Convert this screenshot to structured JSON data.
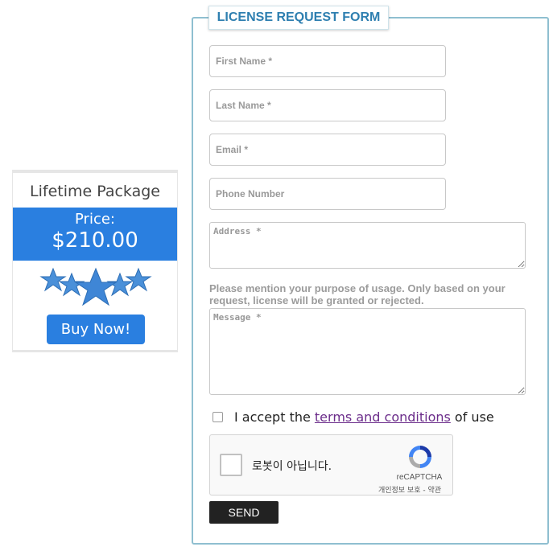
{
  "package": {
    "title": "Lifetime Package",
    "price_label": "Price:",
    "price_value": "$210.00",
    "rating_stars": 5,
    "buy_label": "Buy Now!"
  },
  "form": {
    "legend": "LICENSE REQUEST FORM",
    "first_name_placeholder": "First Name *",
    "last_name_placeholder": "Last Name *",
    "email_placeholder": "Email *",
    "phone_placeholder": "Phone Number",
    "address_placeholder": "Address *",
    "purpose_note": "Please mention your purpose of usage. Only based on your request, license will be granted or rejected.",
    "message_placeholder": "Message *",
    "terms_prefix": "I accept the ",
    "terms_link": "terms and conditions",
    "terms_suffix": " of use",
    "send_label": "SEND"
  },
  "captcha": {
    "label": "로봇이 아닙니다.",
    "brand": "reCAPTCHA",
    "privacy": "개인정보 보호 - 약관"
  },
  "colors": {
    "accent_blue": "#2a7fe0",
    "legend_text": "#2e7fb0",
    "fieldset_border": "#8fbfd0",
    "link_purple": "#6b2c8a"
  }
}
